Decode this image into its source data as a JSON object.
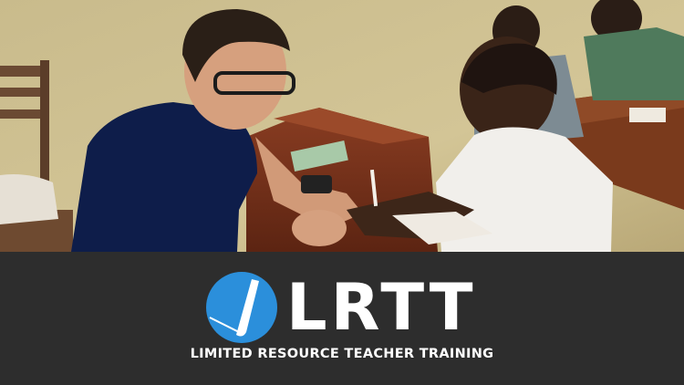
{
  "photo": {
    "subject": "classroom-teaching-photo"
  },
  "brand": {
    "logo_icon": "pencil-circle-icon",
    "logo_color": "#2b8fdb",
    "wordmark": "LRTT",
    "tagline": "LIMITED RESOURCE TEACHER TRAINING",
    "background": "#2d2d2d",
    "text_color": "#ffffff"
  }
}
